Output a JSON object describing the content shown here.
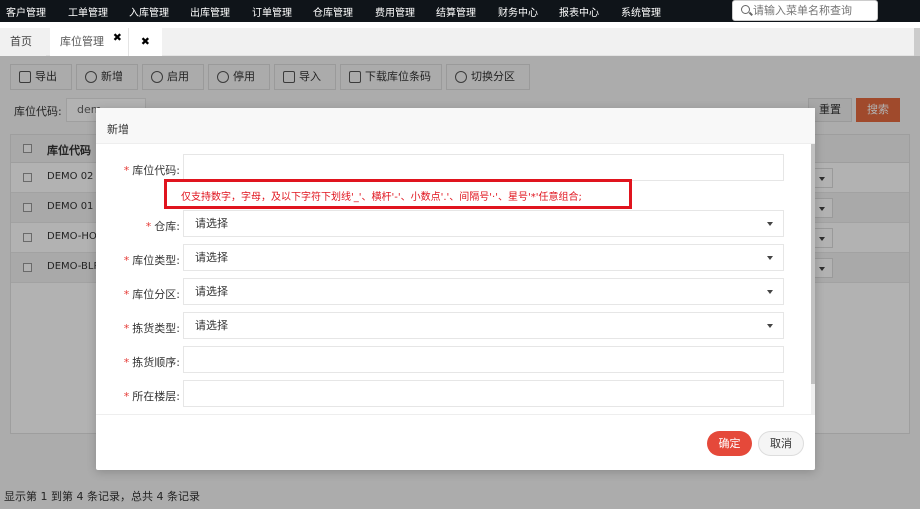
{
  "topnav": {
    "items": [
      "客户管理",
      "工单管理",
      "入库管理",
      "出库管理",
      "订单管理",
      "仓库管理",
      "费用管理",
      "结算管理",
      "财务中心",
      "报表中心",
      "系统管理"
    ],
    "search_placeholder": "请输入菜单名称查询"
  },
  "tabs": [
    {
      "label": "首页"
    },
    {
      "label": "库位管理"
    },
    {
      "label": ""
    }
  ],
  "toolbar": {
    "export": "导出",
    "add": "新增",
    "enable": "启用",
    "disable": "停用",
    "import": "导入",
    "download_barcode": "下载库位条码",
    "switch_zone": "切换分区"
  },
  "filter": {
    "label": "库位代码:",
    "value": "dem",
    "reset": "重置",
    "search": "搜索"
  },
  "grid": {
    "header": "库位代码",
    "rows": [
      "DEMO 02",
      "DEMO 01",
      "DEMO-HOL",
      "DEMO-BLP"
    ]
  },
  "footer_info": "显示第 1 到第 4 条记录，总共 4 条记录",
  "modal": {
    "title": "新增",
    "hint": "仅支持数字，字母，及以下字符下划线'_'、横杆'-'、小数点'.'、间隔号'·'、星号'*'任意组合;",
    "fields": [
      {
        "label": "库位代码:",
        "value": ""
      },
      {
        "label": "仓库:",
        "value": "请选择"
      },
      {
        "label": "库位类型:",
        "value": "请选择"
      },
      {
        "label": "库位分区:",
        "value": "请选择"
      },
      {
        "label": "拣货类型:",
        "value": "请选择"
      },
      {
        "label": "拣货顺序:",
        "value": ""
      },
      {
        "label": "所在楼层:",
        "value": ""
      }
    ],
    "required_mark": "*",
    "ok": "确定",
    "cancel": "取消"
  },
  "colors": {
    "nav_bg": "#0f1419",
    "accent": "#e5493a",
    "hint_border": "#e0141e",
    "search_button": "#e56a3f"
  }
}
